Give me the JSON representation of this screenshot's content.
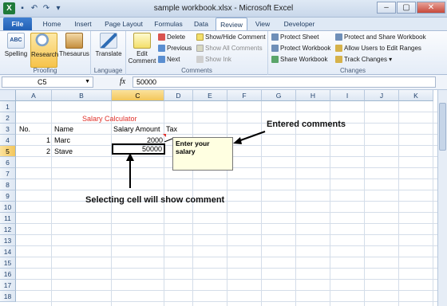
{
  "window": {
    "title": "sample workbook.xlsx - Microsoft Excel",
    "controls": [
      "–",
      "▢",
      "✕"
    ]
  },
  "tabs": [
    {
      "label": "File"
    },
    {
      "label": "Home"
    },
    {
      "label": "Insert"
    },
    {
      "label": "Page Layout"
    },
    {
      "label": "Formulas"
    },
    {
      "label": "Data"
    },
    {
      "label": "Review"
    },
    {
      "label": "View"
    },
    {
      "label": "Developer"
    }
  ],
  "active_tab": "Review",
  "ribbon": {
    "proofing": {
      "label": "Proofing",
      "spelling": "Spelling",
      "research": "Research",
      "thesaurus": "Thesaurus"
    },
    "language": {
      "label": "Language",
      "translate": "Translate"
    },
    "comments": {
      "label": "Comments",
      "edit_comment_1": "Edit",
      "edit_comment_2": "Comment",
      "delete": "Delete",
      "previous": "Previous",
      "next": "Next",
      "show_hide": "Show/Hide Comment",
      "show_all": "Show All Comments",
      "show_ink": "Show Ink"
    },
    "changes": {
      "label": "Changes",
      "protect_sheet": "Protect Sheet",
      "protect_workbook": "Protect Workbook",
      "share_workbook": "Share Workbook",
      "protect_share": "Protect and Share Workbook",
      "allow_edit": "Allow Users to Edit Ranges",
      "track_changes": "Track Changes ▾"
    }
  },
  "formula_bar": {
    "name_box": "C5",
    "fx": "fx",
    "value": "50000"
  },
  "columns": [
    "A",
    "B",
    "C",
    "D",
    "E",
    "F",
    "G",
    "H",
    "I",
    "J",
    "K"
  ],
  "rows": [
    "1",
    "2",
    "3",
    "4",
    "5",
    "6",
    "7",
    "8",
    "9",
    "10",
    "11",
    "12",
    "13",
    "14",
    "15",
    "16",
    "17",
    "18"
  ],
  "selected_cell": {
    "column": "C",
    "row": "5"
  },
  "cells": {
    "title": "Salary Calculator",
    "hdr_no": "No.",
    "hdr_name": "Name",
    "hdr_salary": "Salary Amount",
    "hdr_tax": "Tax",
    "r4_no": "1",
    "r4_name": "Marc",
    "r4_salary": "2000",
    "r5_no": "2",
    "r5_name": "Stave",
    "r5_salary": "50000"
  },
  "comment": {
    "text": "Enter your salary"
  },
  "annotations": {
    "entered": "Entered comments",
    "selecting": "Selecting cell will show comment"
  },
  "colors": {
    "title_red": "#e0312b",
    "selection": "#000000",
    "comment_bg": "#ffffe1"
  }
}
